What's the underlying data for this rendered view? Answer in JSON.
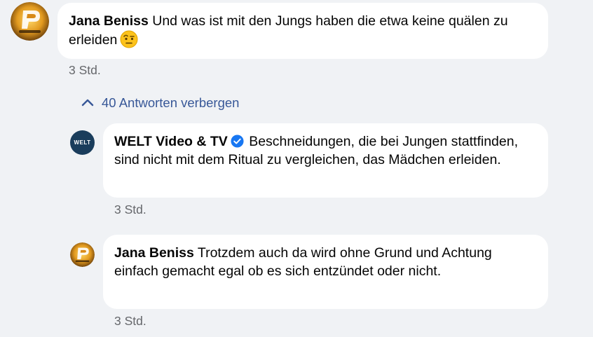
{
  "comments": [
    {
      "author": "Jana Beniss",
      "text": "Und was ist mit den Jungs haben die etwa keine quälen zu erleiden",
      "emoji": "face-with-raised-eyebrow",
      "time": "3 Std."
    },
    {
      "author": "WELT Video & TV",
      "verified": true,
      "text": "Beschneidungen, die bei Jungen stattfinden, sind nicht mit dem Ritual zu vergleichen, das Mädchen erleiden.",
      "time": "3 Std."
    },
    {
      "author": "Jana Beniss",
      "text": "Trotzdem auch da wird ohne Grund und Achtung einfach gemacht egal ob es sich entzündet oder nicht.",
      "time": "3 Std."
    }
  ],
  "replies_toggle": "40 Antworten verbergen",
  "welt_logo_text": "WELT",
  "colors": {
    "background": "#f0f2f5",
    "bubble": "#ffffff",
    "link": "#385898",
    "meta": "#65676b",
    "verified": "#1877f2",
    "welt_avatar": "#1a3d5c"
  }
}
